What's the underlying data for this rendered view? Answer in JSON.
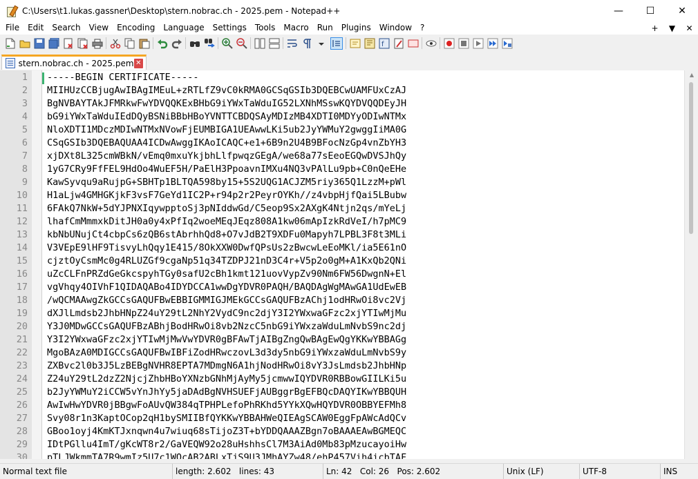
{
  "window": {
    "title": "C:\\Users\\t1.lukas.gassner\\Desktop\\stern.nobrac.ch - 2025.pem - Notepad++",
    "minimize": "—",
    "maximize": "☐",
    "close": "✕"
  },
  "menu": {
    "items": [
      "File",
      "Edit",
      "Search",
      "View",
      "Encoding",
      "Language",
      "Settings",
      "Tools",
      "Macro",
      "Run",
      "Plugins",
      "Window",
      "?"
    ],
    "right": [
      "+",
      "▼",
      "✕"
    ]
  },
  "toolbar": {
    "icons": [
      "new-file-icon",
      "open-file-icon",
      "save-icon",
      "save-all-icon",
      "close-icon",
      "close-all-icon",
      "print-icon",
      "cut-icon",
      "copy-icon",
      "paste-icon",
      "undo-icon",
      "redo-icon",
      "find-icon",
      "replace-icon",
      "zoom-in-icon",
      "zoom-out-icon",
      "sync-vertical-icon",
      "sync-horizontal-icon",
      "word-wrap-icon",
      "show-all-chars-icon",
      "indent-guide-icon",
      "udl-icon",
      "doc-map-icon",
      "function-list-icon",
      "folder-workspace-icon",
      "monitoring-icon",
      "record-macro-icon",
      "stop-record-icon",
      "play-macro-icon",
      "run-macro-multiple-icon",
      "save-macro-icon"
    ]
  },
  "tab": {
    "label": "stern.nobrac.ch - 2025.pem",
    "close": "✕"
  },
  "editor": {
    "lines": [
      "-----BEGIN CERTIFICATE-----",
      "MIIHUzCCBjugAwIBAgIMEuL+zRTLfZ9vC0kRMA0GCSqGSIb3DQEBCwUAMFUxCzAJ",
      "BgNVBAYTAkJFMRkwFwYDVQQKExBHbG9iYWxTaWduIG52LXNhMSswKQYDVQQDEyJH",
      "bG9iYWxTaWduIEdDQyBSNiBBbHBoYVNTTCBDQSAyMDIzMB4XDTI0MDYyODIwNTMx",
      "NloXDTI1MDczMDIwNTMxNVowFjEUMBIGA1UEAwwLKi5ub2JyYWMuY2gwggIiMA0G",
      "CSqGSIb3DQEBAQUAA4ICDwAwggIKAoICAQC+e1+6B9n2U4B9BFocNzGp4vnZbYH3",
      "xjDXt8L325cmWBkN/vEmq0mxuYkjbhLlfpwqzGEgA/we68a77sEeoEGQwDVSJhQy",
      "1yG7CRy9FfFEL9HdOo4WuEF5H/PaElH3PpoavnIMXu4NQ3vPAlLu9pb+C0nQeEHe",
      "KawSyvqu9aRujpG+SBHTp1BLTQA598by15+5S2UQG1ACJZM5riy365Q1LzzM+pWl",
      "H1aLjw4GMHGKjkF3vsF7GeYd1IC2P+r94p2r2PeyrOYKh//z4vbpHjfQai5LBubw",
      "6FAkQ7NkW+5dYJPNXIqywpptoSj3pNIddwGd/C5eop9Sx2AXgK4Ntjn2qs/mYeLj",
      "lhafCmMmmxkDitJH0a0y4xPfIq2woeMEqJEqz808A1kw06mApIzkRdVeI/h7pMC9",
      "kbNbUNujCt4cbpCs6zQB6stAbrhhQd8+O7vJdB2T9XDFu0Mapyh7LPBL3F8t3MLi",
      "V3VEpE9lHF9TisvyLhQqy1E415/8OkXXW0DwfQPsUs2zBwcwLeEoMKl/ia5E61nO",
      "cjztOyCsmMc0g4RLUZGf9cgaNp51q34TZDPJ21nD3C4r+V5p2o0gM+A1KxQb2QNi",
      "uZcCLFnPRZdGeGkcspyhTGy0safU2cBh1kmt121uovVypZv90Nm6FW56DwgnN+El",
      "vgVhqy4OIVhF1QIDAQABo4IDYDCCA1wwDgYDVR0PAQH/BAQDAgWgMAwGA1UdEwEB",
      "/wQCMAAwgZkGCCsGAQUFBwEBBIGMMIGJMEkGCCsGAQUFBzAChj1odHRwOi8vc2Vj",
      "dXJlLmdsb2JhbHNpZ24uY29tL2NhY2VydC9nc2djY3I2YWxwaGFzc2xjYTIwMjMu",
      "Y3J0MDwGCCsGAQUFBzABhjBodHRwOi8vb2NzcC5nbG9iYWxzaWduLmNvbS9nc2dj",
      "Y3I2YWxwaGFzc2xjYTIwMjMwVwYDVR0gBFAwTjAIBgZngQwBAgEwQgYKKwYBBAGg",
      "MgoBAzA0MDIGCCsGAQUFBwIBFiZodHRwczovL3d3dy5nbG9iYWxzaWduLmNvbS9y",
      "ZXBvc2l0b3J5LzBEBgNVHR8EPTA7MDmgN6A1hjNodHRwOi8vY3JsLmdsb2JhbHNp",
      "Z24uY29tL2dzZ2NjcjZhbHBoYXNzbGNhMjAyMy5jcmwwIQYDVR0RBBowGIILKi5u",
      "b2JyYWMuY2iCCW5vYnJhYy5jaDAdBgNVHSUEFjAUBggrBgEFBQcDAQYIKwYBBQUH",
      "AwIwHwYDVR0jBBgwFoAUvQW384qTPHPLefoPhRKhd5YYkXQwHQYDVR0OBBYEFMh8",
      "Svy08r1n3KaptOCop2qH1bySMIIBfQYKKwYBBAHWeQIEAgSCAW0EggFpAWcAdQCv",
      "GBoo1oyj4KmKTJxnqwn4u7wiuq68sTijoZ3T+bYDDQAAAZBgn7oBAAAEAwBGMEQC",
      "IDtPGllu4ImT/gKcWT8r2/GaVEQW92o28uHshhsCl7M3AiAd0Mb83pMzucayoiHw",
      "pTLJWkmmTA7R9wmIz5U7c1WOcAB2ABLxTjS9U3JMhAYZw48/ehP457Vih4icbTAF"
    ]
  },
  "status": {
    "filetype": "Normal text file",
    "length": "length: 2.602",
    "lines": "lines: 43",
    "ln": "Ln: 42",
    "col": "Col: 26",
    "pos": "Pos: 2.602",
    "eol": "Unix (LF)",
    "encoding": "UTF-8",
    "mode": "INS"
  }
}
